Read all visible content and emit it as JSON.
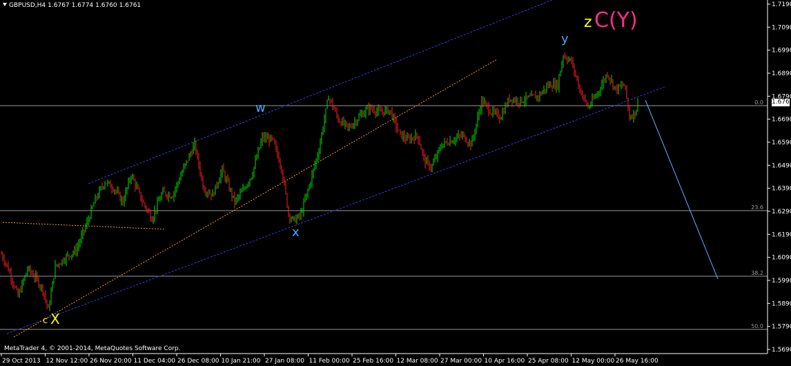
{
  "header": {
    "symbol": "GBPUSD,H4",
    "open": "1.6767",
    "high": "1.6774",
    "low": "1.6760",
    "close": "1.6761"
  },
  "footer": {
    "copyright": "MetaTrader 4, © 2001-2014, MetaQuotes Software Corp."
  },
  "current_price_label": "1.6761",
  "wave_labels": {
    "w": "w",
    "x_lower": "x",
    "y": "y",
    "c_small": "c",
    "X_big": "X",
    "z": "z",
    "CY": "C(Y)"
  },
  "fib_labels": [
    "0.0",
    "23.6",
    "38.2",
    "50.0"
  ],
  "colors": {
    "background": "#000000",
    "axis": "#ffffff",
    "bull_candle": "#00e000",
    "bear_candle": "#ff2020",
    "channel": "#2f3fd8",
    "dotted_trend": "#ff9a2a",
    "projection": "#60b0ff",
    "fib": "#9a9a9a",
    "wave_cyan": "#3fa8ff",
    "wave_yellow": "#ffff00",
    "wave_pink": "#ff2d8c"
  },
  "chart_data": {
    "type": "candlestick",
    "title": "GBPUSD,H4",
    "y_ticks": [
      "1.7190",
      "1.7090",
      "1.6990",
      "1.6890",
      "1.6790",
      "1.6690",
      "1.6590",
      "1.6490",
      "1.6390",
      "1.6290",
      "1.6190",
      "1.6090",
      "1.5990",
      "1.5890",
      "1.5790",
      "1.5690"
    ],
    "ylim": [
      1.569,
      1.719
    ],
    "x_ticks": [
      "29 Oct 2013",
      "12 Nov 12:00",
      "26 Nov 20:00",
      "11 Dec 04:00",
      "26 Dec 08:00",
      "10 Jan 21:00",
      "27 Jan 08:00",
      "11 Feb 00:00",
      "25 Feb 16:00",
      "12 Mar 08:00",
      "27 Mar 00:00",
      "10 Apr 16:00",
      "25 Apr 08:00",
      "12 May 00:00",
      "26 May 16:00"
    ],
    "price_path": [
      [
        0,
        1.6118
      ],
      [
        12,
        1.604
      ],
      [
        26,
        1.592
      ],
      [
        40,
        1.604
      ],
      [
        52,
        1.6
      ],
      [
        62,
        1.595
      ],
      [
        70,
        1.586
      ],
      [
        80,
        1.605
      ],
      [
        95,
        1.609
      ],
      [
        110,
        1.612
      ],
      [
        125,
        1.623
      ],
      [
        138,
        1.634
      ],
      [
        152,
        1.642
      ],
      [
        165,
        1.639
      ],
      [
        178,
        1.633
      ],
      [
        190,
        1.645
      ],
      [
        205,
        1.634
      ],
      [
        220,
        1.626
      ],
      [
        235,
        1.637
      ],
      [
        250,
        1.636
      ],
      [
        268,
        1.649
      ],
      [
        282,
        1.658
      ],
      [
        295,
        1.639
      ],
      [
        308,
        1.636
      ],
      [
        322,
        1.647
      ],
      [
        340,
        1.633
      ],
      [
        352,
        1.638
      ],
      [
        365,
        1.645
      ],
      [
        380,
        1.661
      ],
      [
        395,
        1.66
      ],
      [
        408,
        1.648
      ],
      [
        418,
        1.628
      ],
      [
        425,
        1.625
      ],
      [
        435,
        1.627
      ],
      [
        448,
        1.64
      ],
      [
        462,
        1.656
      ],
      [
        476,
        1.679
      ],
      [
        490,
        1.669
      ],
      [
        505,
        1.665
      ],
      [
        520,
        1.67
      ],
      [
        535,
        1.674
      ],
      [
        550,
        1.672
      ],
      [
        565,
        1.673
      ],
      [
        578,
        1.663
      ],
      [
        590,
        1.66
      ],
      [
        605,
        1.662
      ],
      [
        615,
        1.651
      ],
      [
        625,
        1.648
      ],
      [
        640,
        1.658
      ],
      [
        655,
        1.66
      ],
      [
        670,
        1.662
      ],
      [
        683,
        1.658
      ],
      [
        698,
        1.677
      ],
      [
        712,
        1.672
      ],
      [
        725,
        1.67
      ],
      [
        738,
        1.678
      ],
      [
        752,
        1.677
      ],
      [
        765,
        1.678
      ],
      [
        780,
        1.679
      ],
      [
        795,
        1.684
      ],
      [
        808,
        1.684
      ],
      [
        816,
        1.697
      ],
      [
        828,
        1.694
      ],
      [
        840,
        1.682
      ],
      [
        852,
        1.674
      ],
      [
        865,
        1.68
      ],
      [
        880,
        1.689
      ],
      [
        892,
        1.682
      ],
      [
        905,
        1.684
      ],
      [
        912,
        1.67
      ],
      [
        920,
        1.672
      ],
      [
        925,
        1.6761
      ]
    ],
    "fib_levels": [
      {
        "label": "0.0",
        "value": 1.6761
      },
      {
        "label": "23.6",
        "value": 1.63
      },
      {
        "label": "38.2",
        "value": 1.6
      },
      {
        "label": "50.0",
        "value": 1.5785
      }
    ]
  }
}
